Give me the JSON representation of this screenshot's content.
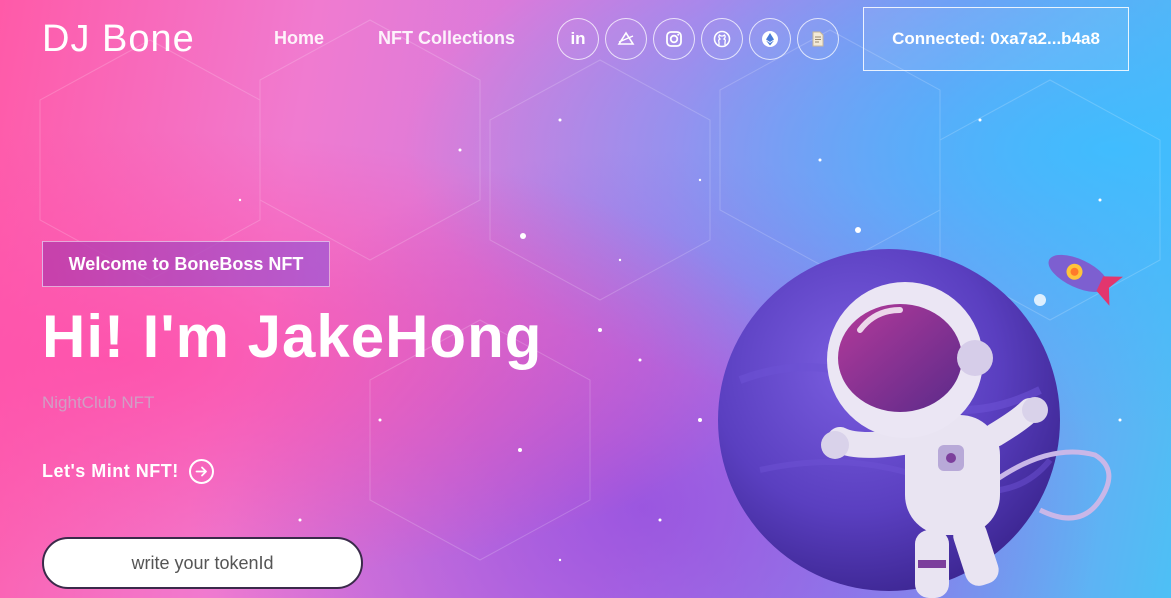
{
  "brand": {
    "logo_text": "DJ Bone"
  },
  "nav": {
    "links": [
      {
        "label": "Home"
      },
      {
        "label": "NFT Collections"
      }
    ],
    "socials": [
      {
        "icon": "linkedin-icon",
        "glyph": "in"
      },
      {
        "icon": "opensea-icon"
      },
      {
        "icon": "instagram-icon"
      },
      {
        "icon": "github-icon"
      },
      {
        "icon": "ethereum-icon"
      },
      {
        "icon": "document-icon"
      }
    ],
    "wallet_button": "Connected: 0xa7a2...b4a8"
  },
  "hero": {
    "badge": "Welcome to BoneBoss NFT",
    "title": "Hi! I'm JakeHong",
    "subtitle": "NightClub NFT",
    "cta": "Let's Mint NFT!",
    "token_placeholder": "write your tokenId"
  },
  "colors": {
    "text": "#ffffff",
    "planet": "#5a3fc0",
    "accent_pink": "#ff5aa8",
    "accent_blue": "#4dc0f5"
  }
}
